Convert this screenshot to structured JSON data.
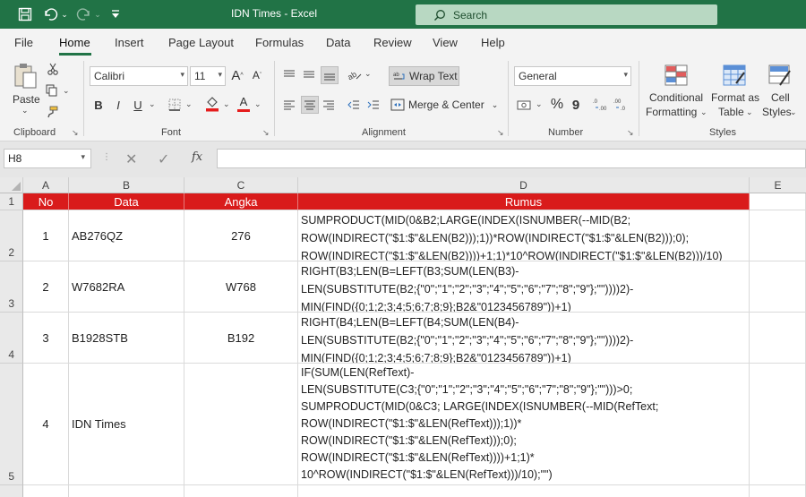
{
  "titlebar": {
    "title": "IDN Times  -  Excel",
    "search_placeholder": "Search",
    "colors": {
      "bar": "#217346"
    }
  },
  "tabs": [
    "File",
    "Home",
    "Insert",
    "Page Layout",
    "Formulas",
    "Data",
    "Review",
    "View",
    "Help"
  ],
  "active_tab": "Home",
  "ribbon": {
    "clipboard": {
      "paste": "Paste",
      "group": "Clipboard"
    },
    "font": {
      "family": "Calibri",
      "size": "11",
      "bold": "B",
      "italic": "I",
      "underline": "U",
      "grow": "A",
      "shrink": "A",
      "font_color": "A",
      "group": "Font"
    },
    "alignment": {
      "wrap": "Wrap Text",
      "merge": "Merge & Center",
      "group": "Alignment"
    },
    "number": {
      "format": "General",
      "percent": "%",
      "comma": "9",
      "group": "Number"
    },
    "styles": {
      "conditional": "Conditional",
      "conditional2": "Formatting",
      "format_as": "Format as",
      "format_as2": "Table",
      "cell": "Cell",
      "cell2": "Styles",
      "group": "Styles"
    }
  },
  "formula_bar": {
    "name_box": "H8",
    "fx": "fx",
    "content": ""
  },
  "grid": {
    "columns": [
      "A",
      "B",
      "C",
      "D",
      "E"
    ],
    "rows": [
      "1",
      "2",
      "3",
      "4",
      "5"
    ],
    "header": {
      "no": "No",
      "data": "Data",
      "angka": "Angka",
      "rumus": "Rumus",
      "color": "#d91b1b"
    },
    "data_rows": [
      {
        "no": "1",
        "data": "AB276QZ",
        "angka": "276",
        "rumus": "SUMPRODUCT(MID(0&B2;LARGE(INDEX(ISNUMBER(--MID(B2;\nROW(INDIRECT(\"$1:$\"&LEN(B2)));1))*ROW(INDIRECT(\"$1:$\"&LEN(B2)));0);\nROW(INDIRECT(\"$1:$\"&LEN(B2))))+1;1)*10^ROW(INDIRECT(\"$1:$\"&LEN(B2)))/10)"
      },
      {
        "no": "2",
        "data": "W7682RA",
        "angka": "W768",
        "rumus": "RIGHT(B3;LEN(B=LEFT(B3;SUM(LEN(B3)-\nLEN(SUBSTITUTE(B2;{\"0\";\"1\";\"2\";\"3\";\"4\";\"5\";\"6\";\"7\";\"8\";\"9\"};\"\"))))2)-\nMIN(FIND({0;1;2;3;4;5;6;7;8;9};B2&\"0123456789\"))+1)"
      },
      {
        "no": "3",
        "data": "B1928STB",
        "angka": "B192",
        "rumus": "RIGHT(B4;LEN(B=LEFT(B4;SUM(LEN(B4)-\nLEN(SUBSTITUTE(B2;{\"0\";\"1\";\"2\";\"3\";\"4\";\"5\";\"6\";\"7\";\"8\";\"9\"};\"\"))))2)-\nMIN(FIND({0;1;2;3;4;5;6;7;8;9};B2&\"0123456789\"))+1)"
      },
      {
        "no": "4",
        "data": "IDN Times",
        "angka": "",
        "rumus": "IF(SUM(LEN(RefText)-\nLEN(SUBSTITUTE(C3;{\"0\";\"1\";\"2\";\"3\";\"4\";\"5\";\"6\";\"7\";\"8\";\"9\"};\"\")))>0;\nSUMPRODUCT(MID(0&C3; LARGE(INDEX(ISNUMBER(--MID(RefText;\nROW(INDIRECT(\"$1:$\"&LEN(RefText)));1))*\nROW(INDIRECT(\"$1:$\"&LEN(RefText)));0);\nROW(INDIRECT(\"$1:$\"&LEN(RefText))))+1;1)*\n10^ROW(INDIRECT(\"$1:$\"&LEN(RefText)))/10);\"\")"
      }
    ]
  }
}
